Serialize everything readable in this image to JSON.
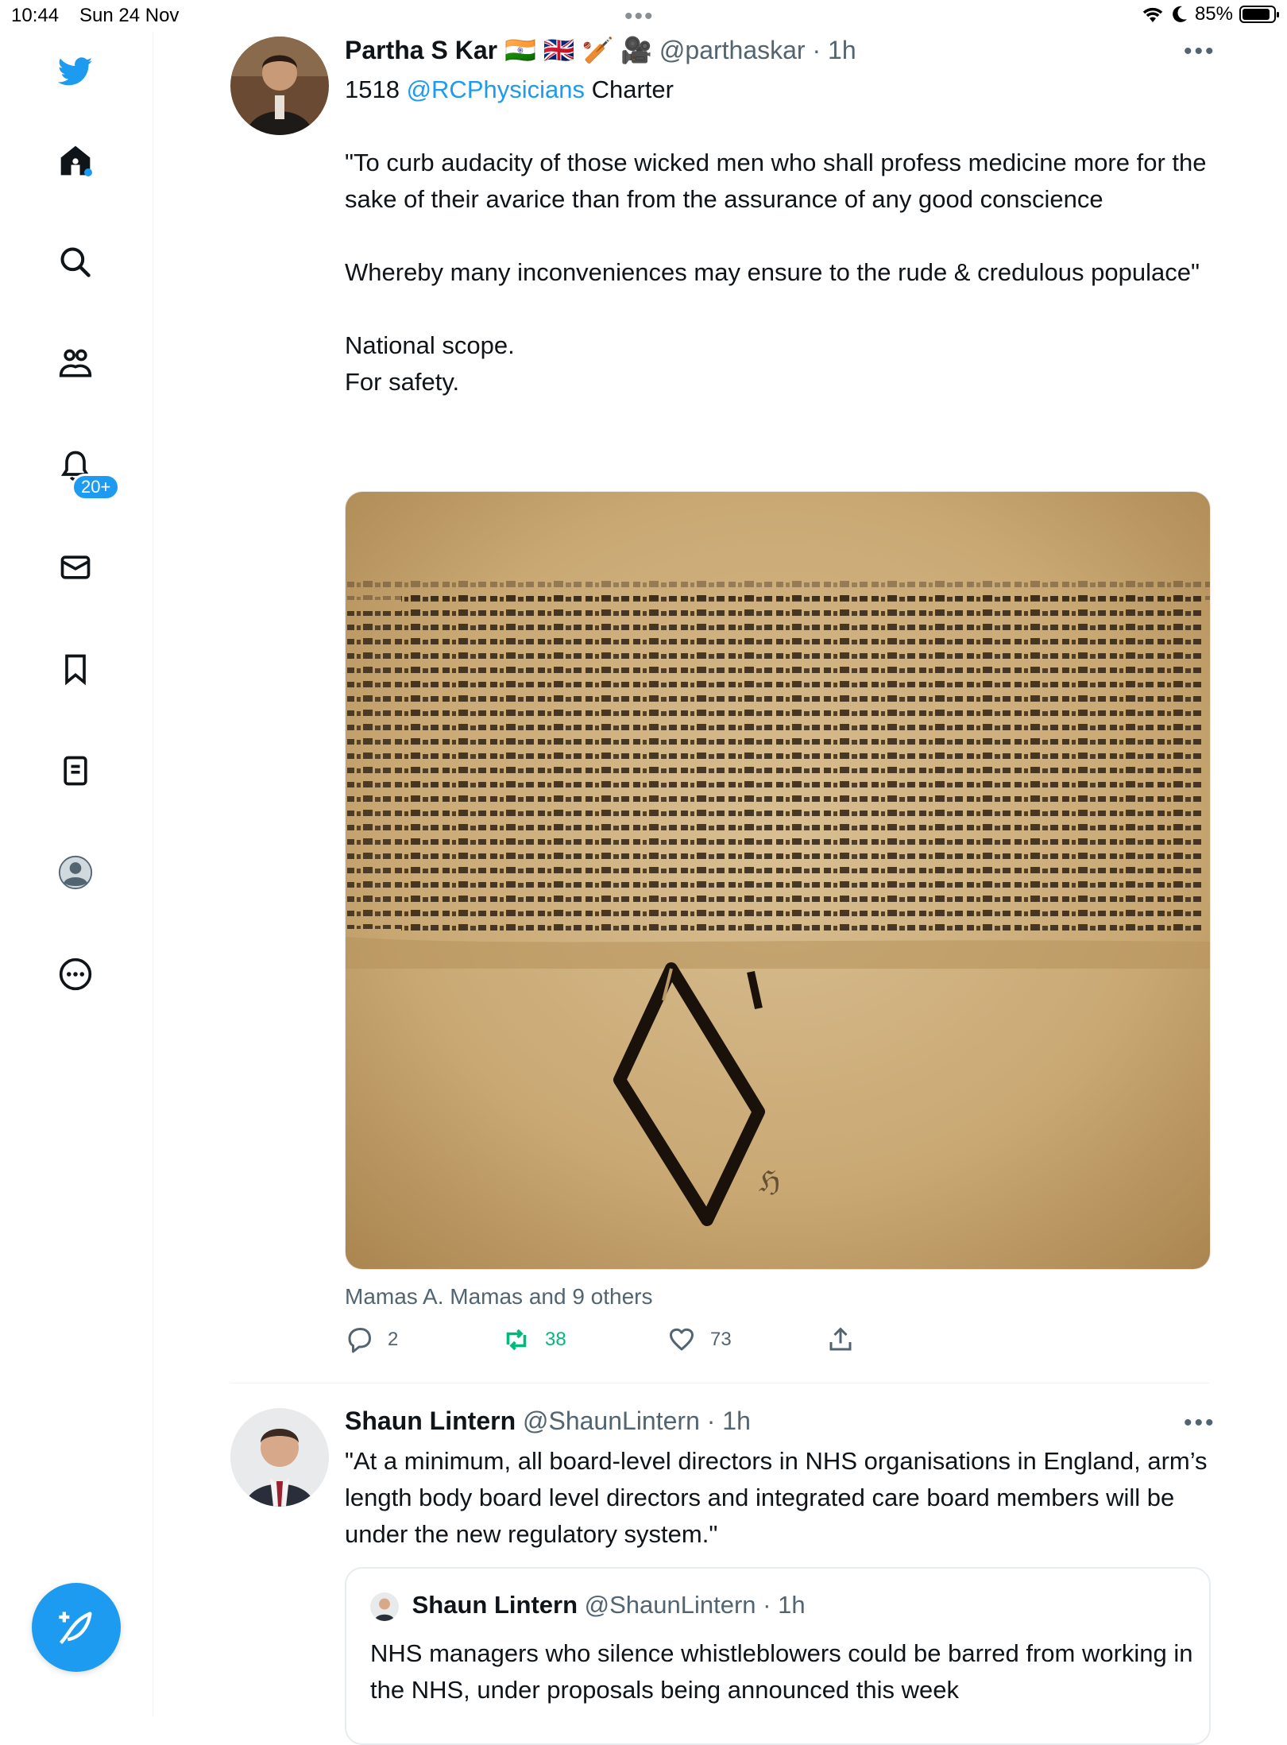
{
  "status_bar": {
    "time": "10:44",
    "date": "Sun 24 Nov",
    "battery": "85%"
  },
  "sidebar": {
    "notifications_badge": "20+",
    "items": [
      "twitter-logo",
      "home",
      "search",
      "communities",
      "notifications",
      "messages",
      "bookmarks",
      "lists",
      "profile",
      "more"
    ]
  },
  "tweet1": {
    "name": "Partha S Kar",
    "name_emojis": "🇮🇳 🇬🇧 🏏 🎥",
    "handle": "@parthaskar",
    "time": "1h",
    "text_prefix": "1518 ",
    "mention": "@RCPhysicians",
    "text_suffix": " Charter",
    "body": "\"To curb audacity of those wicked men who shall profess medicine more for the sake of their avarice than from the assurance of any good conscience\n\nWhereby many inconveniences may ensure to the rude & credulous populace\"\n\nNational scope.\nFor safety.",
    "liked_by": "Mamas A. Mamas and 9 others",
    "replies": "2",
    "retweets": "38",
    "likes": "73"
  },
  "tweet2": {
    "name": "Shaun Lintern",
    "handle": "@ShaunLintern",
    "time": "1h",
    "body": "\"At a minimum, all board-level directors in NHS organisations in England, arm’s length body board level directors and integrated care board members will be under the new regulatory system.\"",
    "quote": {
      "name": "Shaun Lintern",
      "handle": "@ShaunLintern",
      "time": "1h",
      "body": "NHS managers who silence whistleblowers could be barred from working in the NHS, under proposals being announced this week"
    }
  },
  "colors": {
    "accent": "#1d9bf0",
    "retweet": "#00ba7c",
    "text": "#0f1419",
    "muted": "#536471"
  }
}
